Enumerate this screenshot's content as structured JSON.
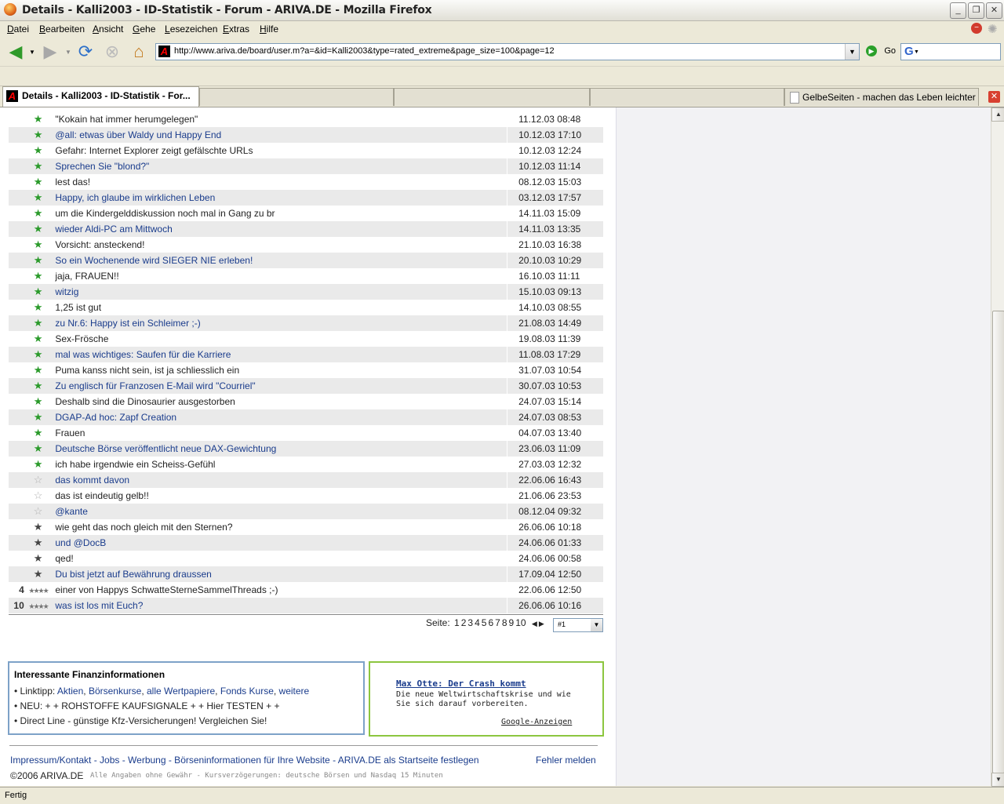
{
  "window": {
    "title": "Details - Kalli2003 - ID-Statistik - Forum - ARIVA.DE - Mozilla Firefox"
  },
  "menu": [
    "Datei",
    "Bearbeiten",
    "Ansicht",
    "Gehe",
    "Lesezeichen",
    "Extras",
    "Hilfe"
  ],
  "toolbar": {
    "url": "http://www.ariva.de/board/user.m?a=&id=Kalli2003&type=rated_extreme&page_size=100&page=12",
    "go_label": "Go",
    "search_logo": "G"
  },
  "tabs": [
    {
      "label": "Details - Kalli2003 - ID-Statistik - For...",
      "active": true
    },
    {
      "label": "",
      "active": false
    },
    {
      "label": "",
      "active": false
    },
    {
      "label": "GelbeSeiten - machen das Leben leichter",
      "active": false
    }
  ],
  "threads": [
    {
      "num": "",
      "stars": "green",
      "title": "\"Kokain hat immer herumgelegen\"",
      "link": false,
      "date": "11.12.03 08:48"
    },
    {
      "num": "",
      "stars": "green",
      "title": "@all: etwas über Waldy und Happy End",
      "link": true,
      "date": "10.12.03 17:10"
    },
    {
      "num": "",
      "stars": "green",
      "title": "Gefahr: Internet Explorer zeigt gefälschte URLs",
      "link": false,
      "date": "10.12.03 12:24"
    },
    {
      "num": "",
      "stars": "green",
      "title": "Sprechen Sie \"blond?\"",
      "link": true,
      "date": "10.12.03 11:14"
    },
    {
      "num": "",
      "stars": "green",
      "title": "lest das!",
      "link": false,
      "date": "08.12.03 15:03"
    },
    {
      "num": "",
      "stars": "green",
      "title": "Happy, ich glaube im wirklichen Leben",
      "link": true,
      "date": "03.12.03 17:57"
    },
    {
      "num": "",
      "stars": "green",
      "title": "um die Kindergelddiskussion noch mal in Gang zu br",
      "link": false,
      "date": "14.11.03 15:09"
    },
    {
      "num": "",
      "stars": "green",
      "title": "wieder Aldi-PC am Mittwoch",
      "link": true,
      "date": "14.11.03 13:35"
    },
    {
      "num": "",
      "stars": "green",
      "title": "Vorsicht: ansteckend!",
      "link": false,
      "date": "21.10.03 16:38"
    },
    {
      "num": "",
      "stars": "green",
      "title": "So ein Wochenende wird SIEGER NIE erleben!",
      "link": true,
      "date": "20.10.03 10:29"
    },
    {
      "num": "",
      "stars": "green",
      "title": "jaja, FRAUEN!!",
      "link": false,
      "date": "16.10.03 11:11"
    },
    {
      "num": "",
      "stars": "green",
      "title": "witzig",
      "link": true,
      "date": "15.10.03 09:13"
    },
    {
      "num": "",
      "stars": "green",
      "title": "1,25 ist gut",
      "link": false,
      "date": "14.10.03 08:55"
    },
    {
      "num": "",
      "stars": "green",
      "title": "zu Nr.6: Happy ist ein Schleimer ;-)",
      "link": true,
      "date": "21.08.03 14:49"
    },
    {
      "num": "",
      "stars": "green",
      "title": "Sex-Frösche",
      "link": false,
      "date": "19.08.03 11:39"
    },
    {
      "num": "",
      "stars": "green",
      "title": "mal was wichtiges: Saufen für die Karriere",
      "link": true,
      "date": "11.08.03 17:29"
    },
    {
      "num": "",
      "stars": "green",
      "title": "Puma kanss nicht sein, ist ja schliesslich ein",
      "link": false,
      "date": "31.07.03 10:54"
    },
    {
      "num": "",
      "stars": "green",
      "title": "Zu englisch für Franzosen E-Mail wird \"Courriel\"",
      "link": true,
      "date": "30.07.03 10:53"
    },
    {
      "num": "",
      "stars": "green",
      "title": "Deshalb sind die Dinosaurier ausgestorben",
      "link": false,
      "date": "24.07.03 15:14"
    },
    {
      "num": "",
      "stars": "green",
      "title": "DGAP-Ad hoc: Zapf Creation",
      "link": true,
      "date": "24.07.03 08:53"
    },
    {
      "num": "",
      "stars": "green",
      "title": "Frauen",
      "link": false,
      "date": "04.07.03 13:40"
    },
    {
      "num": "",
      "stars": "green",
      "title": "Deutsche Börse veröffentlicht neue DAX-Gewichtung",
      "link": true,
      "date": "23.06.03 11:09"
    },
    {
      "num": "",
      "stars": "green",
      "title": "ich habe irgendwie ein Scheiss-Gefühl",
      "link": false,
      "date": "27.03.03 12:32"
    },
    {
      "num": "",
      "stars": "outline",
      "title": "das kommt davon",
      "link": true,
      "date": "22.06.06 16:43"
    },
    {
      "num": "",
      "stars": "outline",
      "title": "das ist eindeutig gelb!!",
      "link": false,
      "date": "21.06.06 23:53"
    },
    {
      "num": "",
      "stars": "outline",
      "title": "@kante",
      "link": true,
      "date": "08.12.04 09:32"
    },
    {
      "num": "",
      "stars": "black",
      "title": "wie geht das noch gleich mit den Sternen?",
      "link": false,
      "date": "26.06.06 10:18"
    },
    {
      "num": "",
      "stars": "black",
      "title": "und @DocB",
      "link": true,
      "date": "24.06.06 01:33"
    },
    {
      "num": "",
      "stars": "black",
      "title": "qed!",
      "link": false,
      "date": "24.06.06 00:58"
    },
    {
      "num": "",
      "stars": "black",
      "title": "Du bist jetzt auf Bewährung draussen",
      "link": true,
      "date": "17.09.04 12:50"
    },
    {
      "num": "4",
      "stars": "multi",
      "title": "einer von Happys SchwatteSterneSammelThreads ;-)",
      "link": false,
      "date": "22.06.06 12:50"
    },
    {
      "num": "10",
      "stars": "multi",
      "title": "was ist los mit Euch?",
      "link": true,
      "date": "26.06.06 10:16"
    }
  ],
  "pager": {
    "label": "Seite:",
    "pages": [
      "1",
      "2",
      "3",
      "4",
      "5",
      "6",
      "7",
      "8",
      "9",
      "10"
    ],
    "select_value": "#1"
  },
  "finbox": {
    "title": "Interessante Finanzinformationen",
    "line1_prefix": "• Linktipp: ",
    "line1_links": [
      "Aktien",
      "Börsenkurse",
      "alle Wertpapiere",
      "Fonds Kurse",
      "weitere"
    ],
    "line2": "• NEU: + + ROHSTOFFE KAUFSIGNALE + + Hier TESTEN + +",
    "line3": "• Direct Line - günstige Kfz-Versicherungen! Vergleichen Sie!"
  },
  "ad": {
    "title": "Max Otte: Der Crash kommt",
    "text": "Die neue Weltwirtschaftskrise und wie Sie sich darauf vorbereiten.",
    "google": "Google-Anzeigen"
  },
  "footer": {
    "links": "Impressum/Kontakt - Jobs - Werbung - Börseninformationen für Ihre Website - ARIVA.DE als Startseite festlegen",
    "error": "Fehler melden",
    "copyright": "©2006 ARIVA.DE",
    "disclaimer": "Alle Angaben ohne Gewähr - Kursverzögerungen: deutsche Börsen und Nasdaq 15 Minuten"
  },
  "status": "Fertig",
  "colors": {
    "link": "#1a3c8c",
    "star_green": "#2a9a2a",
    "row_alt": "#eaeaea",
    "ad_border": "#8cc63f",
    "fin_border": "#7da2c8"
  }
}
